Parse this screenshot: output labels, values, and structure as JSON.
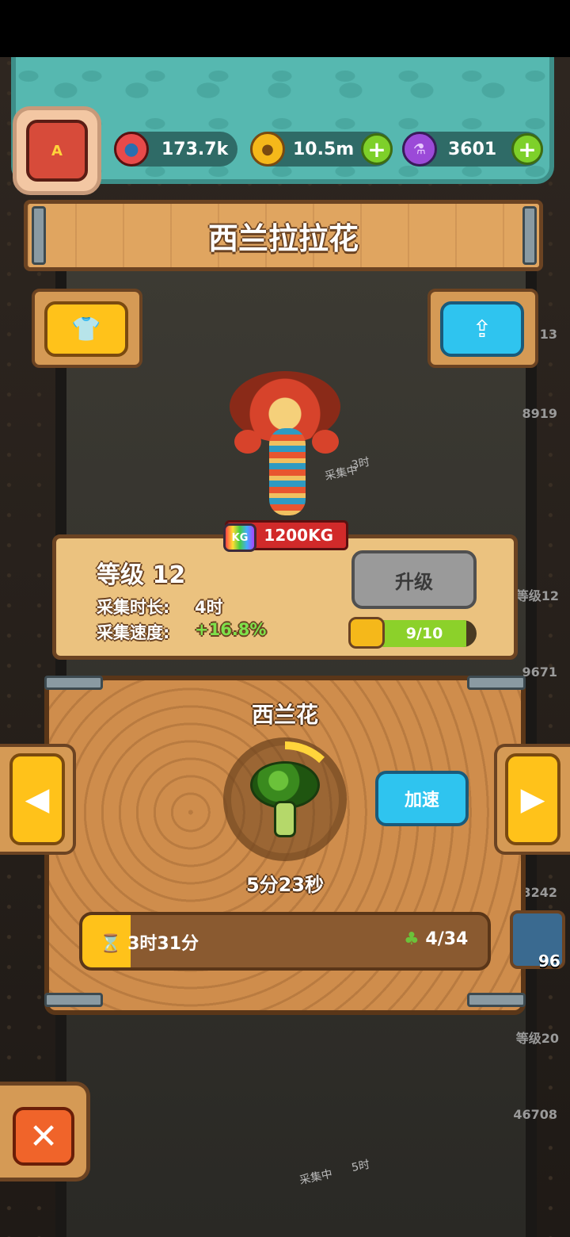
{
  "resources": {
    "eyes": "173.7k",
    "coins": "10.5m",
    "potions": "3601",
    "add_symbol": "+"
  },
  "avatar": {
    "badge": "A"
  },
  "title": "西兰拉拉花",
  "monster": {
    "weight": "1200KG",
    "weight_tag": "KG",
    "level": "等级 12",
    "collect_time_label": "采集时长:",
    "collect_time_value": "4时",
    "collect_speed_label": "采集速度:",
    "collect_speed_value": "+16.8%",
    "upgrade_label": "升级",
    "progress_text": "9/10",
    "progress_fraction": 0.9
  },
  "production": {
    "item_name": "西兰花",
    "speed_up_label": "加速",
    "countdown": "5分23秒",
    "cycle_progress_fraction": 0.12,
    "total_time": "3时31分",
    "count": "4/34",
    "total_progress_fraction": 0.12,
    "side_count": "96"
  },
  "background_labels": {
    "label_a": "13",
    "label_b": "8919",
    "label_c": "等级12",
    "label_d": "9671",
    "label_e": "3242",
    "label_f": "等级20",
    "label_g": "46708",
    "collecting_a": "采集中",
    "collecting_a_time": "3时",
    "collecting_b": "采集中",
    "collecting_b_time": "5时"
  },
  "colors": {
    "accent_yellow": "#ffc21a",
    "accent_blue": "#2fc4ef",
    "progress_green": "#8cd12a",
    "close_orange": "#f0642a"
  },
  "icons": {
    "eye": "eyeball-icon",
    "coin": "coin-icon",
    "potion": "potion-icon",
    "shirt": "shirt-icon",
    "share": "share-icon",
    "left": "chevron-left-icon",
    "right": "chevron-right-icon",
    "hourglass": "hourglass-icon",
    "close": "close-icon"
  }
}
